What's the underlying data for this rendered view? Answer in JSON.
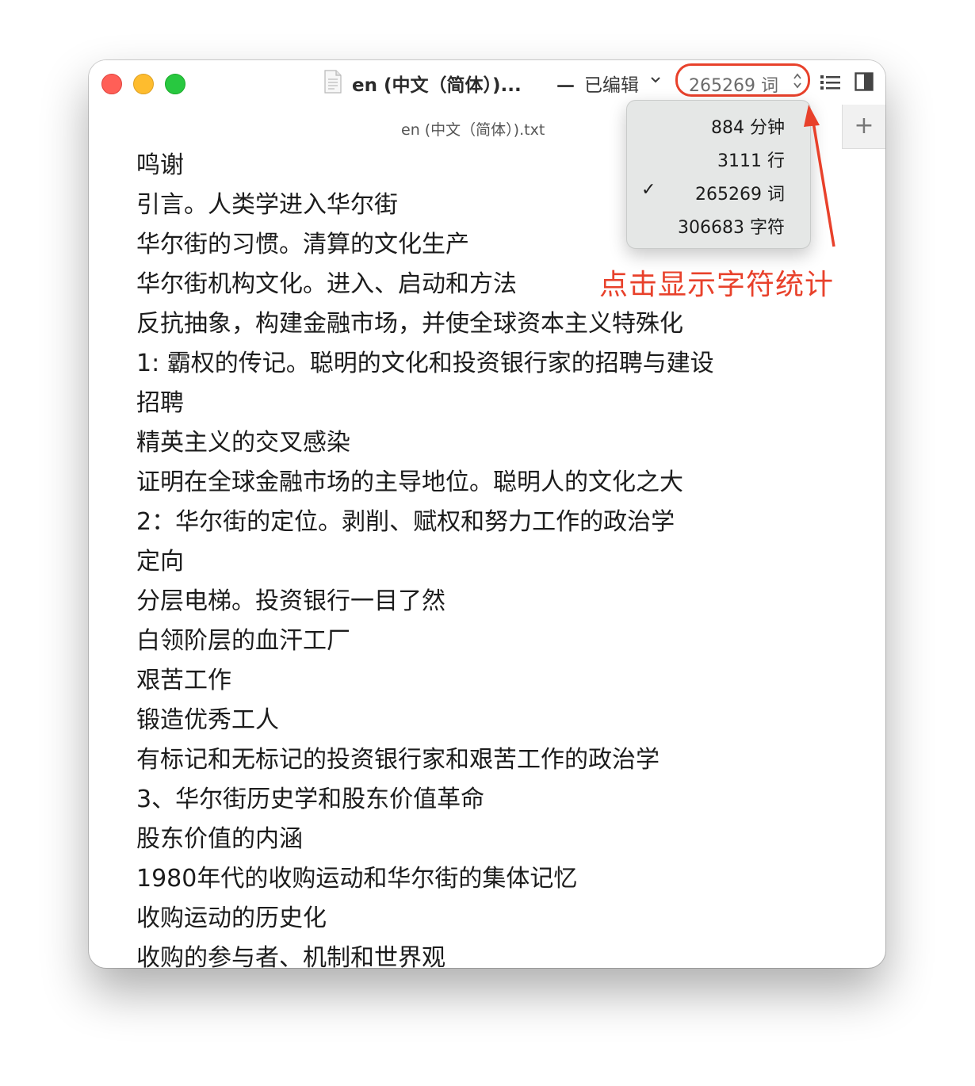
{
  "window": {
    "title": "en (中文（简体）)...",
    "edited_label": "已编辑",
    "dash": "—"
  },
  "counter": {
    "value": "265269 词"
  },
  "tab": {
    "title": "en (中文（简体）).txt",
    "add_label": "+"
  },
  "menu": {
    "items": [
      {
        "label": "884 分钟",
        "checked": false
      },
      {
        "label": "3111 行",
        "checked": false
      },
      {
        "label": "265269 词",
        "checked": true
      },
      {
        "label": "306683 字符",
        "checked": false
      }
    ],
    "check_glyph": "✓"
  },
  "annotation": {
    "text": "点击显示字符统计",
    "color": "#e8412b"
  },
  "document": {
    "lines": [
      "鸣谢",
      "引言。人类学进入华尔街",
      "华尔街的习惯。清算的文化生产",
      "华尔街机构文化。进入、启动和方法",
      "反抗抽象，构建金融市场，并使全球资本主义特殊化",
      "1: 霸权的传记。聪明的文化和投资银行家的招聘与建设",
      "招聘",
      "精英主义的交叉感染",
      "证明在全球金融市场的主导地位。聪明人的文化之大",
      "2：华尔街的定位。剥削、赋权和努力工作的政治学",
      "定向",
      "分层电梯。投资银行一目了然",
      "白领阶层的血汗工厂",
      "艰苦工作",
      "锻造优秀工人",
      "有标记和无标记的投资银行家和艰苦工作的政治学",
      "3、华尔街历史学和股东价值革命",
      "股东价值的内涵",
      "1980年代的收购运动和华尔街的集体记忆",
      "收购运动的历史化",
      "收购的参与者、机制和世界观"
    ]
  },
  "icons": {
    "close": "close-button",
    "minimize": "minimize-button",
    "zoom": "zoom-button",
    "document": "document-icon",
    "list": "list-icon",
    "sidebar": "sidebar-icon"
  }
}
